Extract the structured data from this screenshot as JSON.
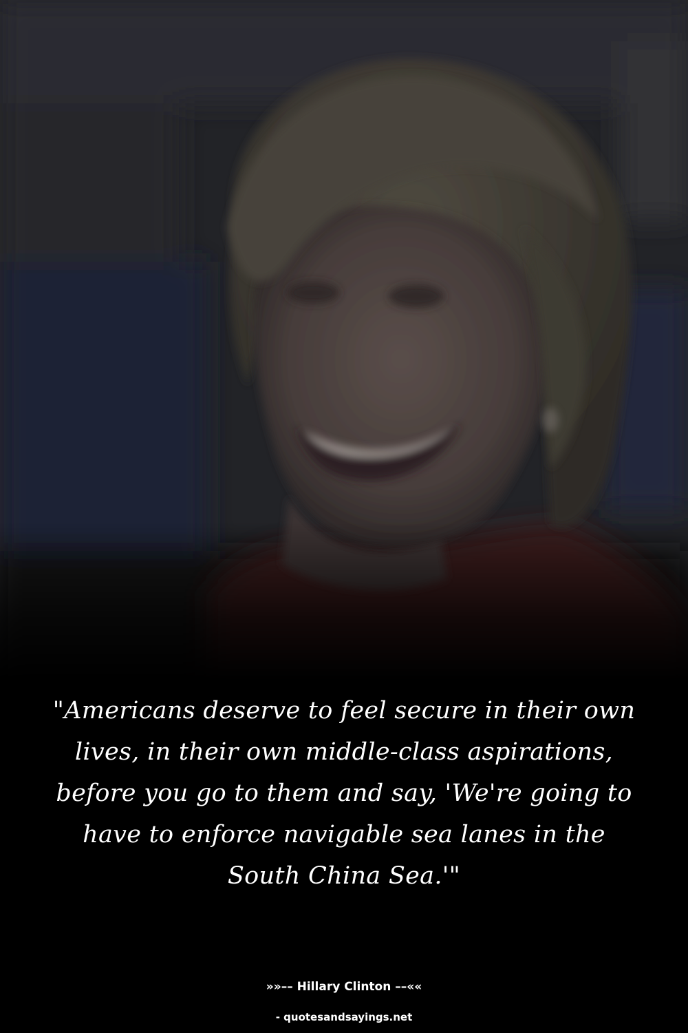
{
  "quote": {
    "text": "\"Americans deserve to feel secure in their own lives, in their own middle-class aspirations, before you go to them and say, 'We're going to have to enforce navigable sea lanes in the South China Sea.'\""
  },
  "attribution": {
    "author_line": "»»–– Hillary Clinton ––««"
  },
  "footer": {
    "source": "- quotesandsayings.net"
  },
  "colors": {
    "background": "#000000",
    "text": "#ffffff"
  }
}
